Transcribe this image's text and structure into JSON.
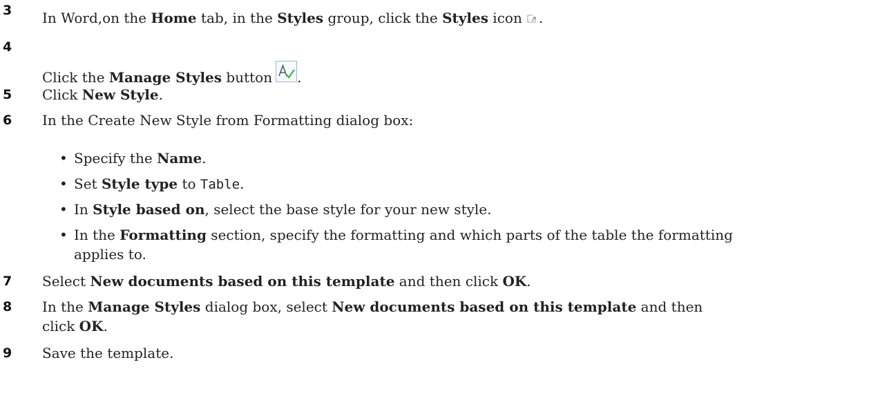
{
  "steps": [
    {
      "num": "3",
      "parts": [
        "In Word,on the ",
        "Home",
        " tab, in the ",
        "Styles",
        " group, click the ",
        "Styles",
        " icon",
        "."
      ],
      "icon": "dialog-launcher-icon"
    },
    {
      "num": "4",
      "parts": [
        "Click the ",
        "Manage Styles",
        " button",
        "."
      ],
      "icon": "manage-styles-icon"
    },
    {
      "num": "5",
      "parts": [
        "Click ",
        "New Style",
        "."
      ]
    },
    {
      "num": "6",
      "text": "In the Create New Style from Formatting dialog box:"
    },
    {
      "num": "7",
      "parts": [
        "Select ",
        "New documents based on this template",
        " and then click ",
        "OK",
        "."
      ]
    },
    {
      "num": "8",
      "parts": [
        "In the ",
        "Manage Styles",
        " dialog box, select ",
        "New documents based on this template",
        " and then",
        "click ",
        "OK",
        "."
      ]
    },
    {
      "num": "9",
      "text": "Save the template."
    }
  ],
  "bullets": [
    {
      "marker": "•",
      "parts": [
        "Specify the ",
        "Name",
        "."
      ]
    },
    {
      "marker": "•",
      "parts": [
        "Set ",
        "Style type",
        " to ",
        "Table",
        "."
      ]
    },
    {
      "marker": "•",
      "parts": [
        "In ",
        "Style based on",
        ", select the base style for your new style."
      ]
    },
    {
      "marker": "•",
      "parts": [
        "In the ",
        "Formatting",
        " section, specify the formatting and which parts of the table the formatting",
        "applies to."
      ]
    }
  ]
}
